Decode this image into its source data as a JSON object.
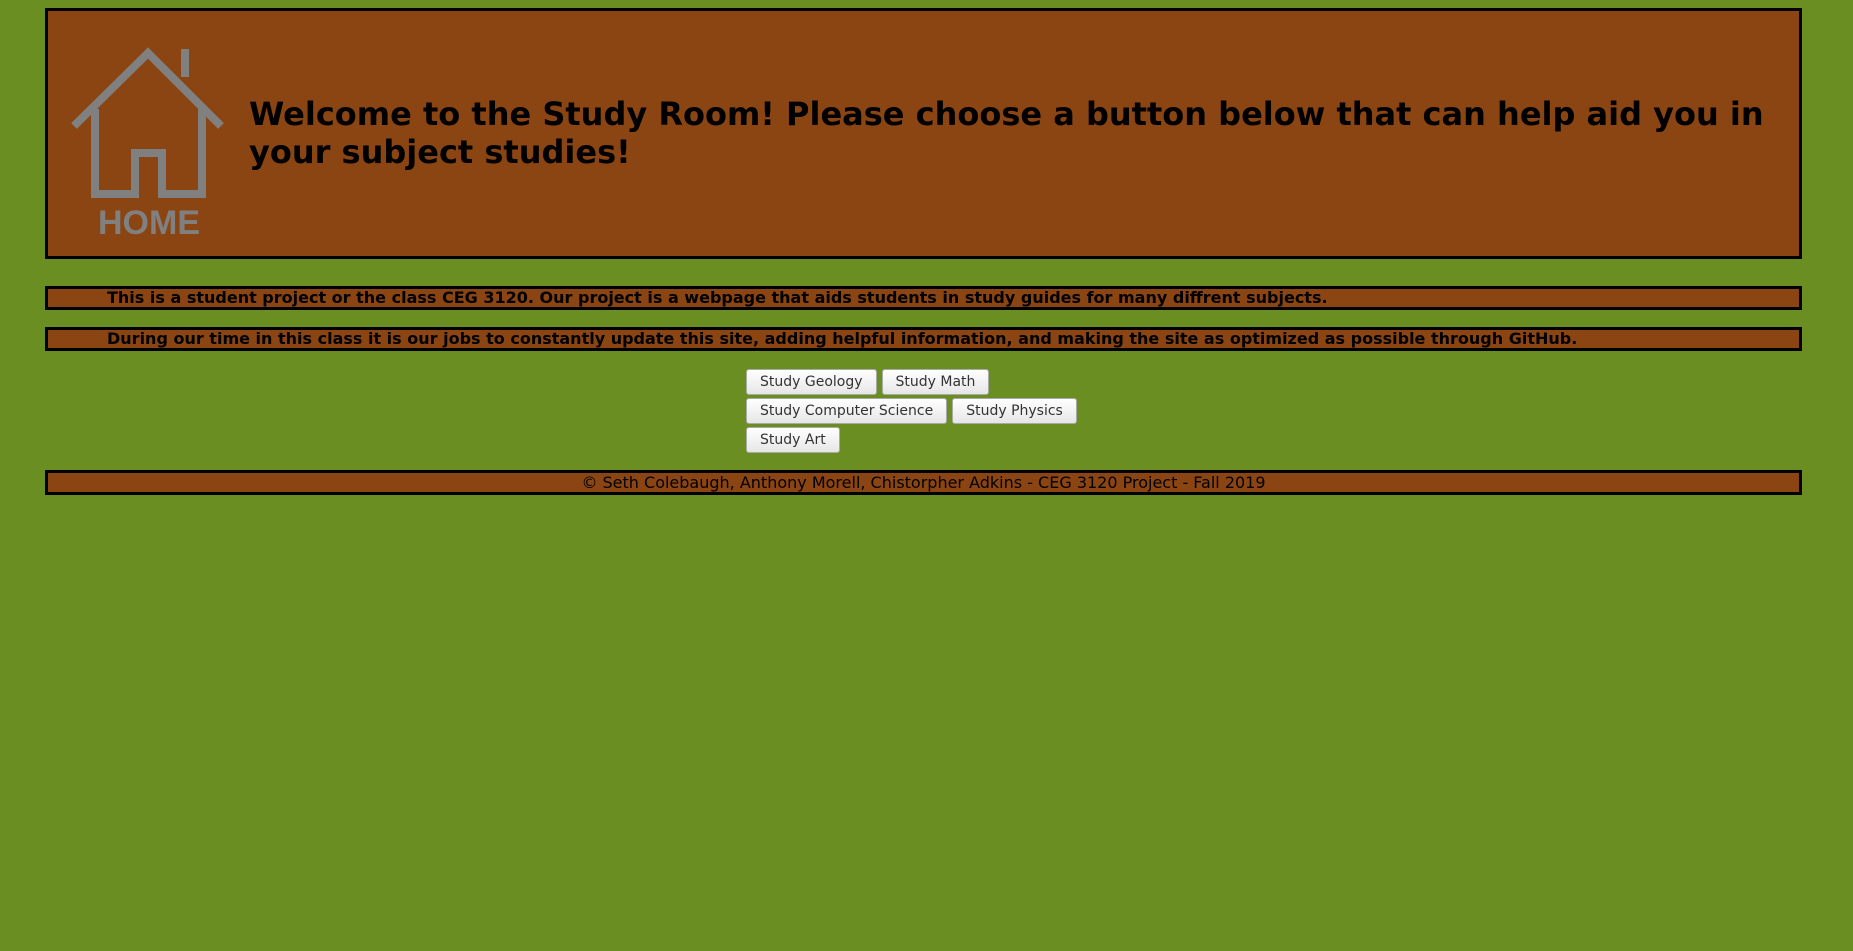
{
  "header": {
    "logo_text": "HOME",
    "headline": "Welcome to the Study Room! Please choose a button below that can help aid you in your subject studies!"
  },
  "banners": [
    "This is a student project or the class CEG 3120. Our project is a webpage that aids students in study guides for many diffrent subjects.",
    "During our time in this class it is our jobs to constantly update this site, adding helpful information, and making the site as optimized as possible through GitHub."
  ],
  "buttons": {
    "geology": "Study Geology",
    "math": "Study Math",
    "computer_science": "Study Computer Science",
    "physics": "Study Physics",
    "art": "Study Art"
  },
  "footer": {
    "text": "© Seth Colebaugh, Anthony Morell, Chistorpher Adkins - CEG 3120 Project - Fall 2019"
  },
  "colors": {
    "page_background": "#6b8e23",
    "panel_background": "#8b4513",
    "logo_gray": "#808080"
  }
}
